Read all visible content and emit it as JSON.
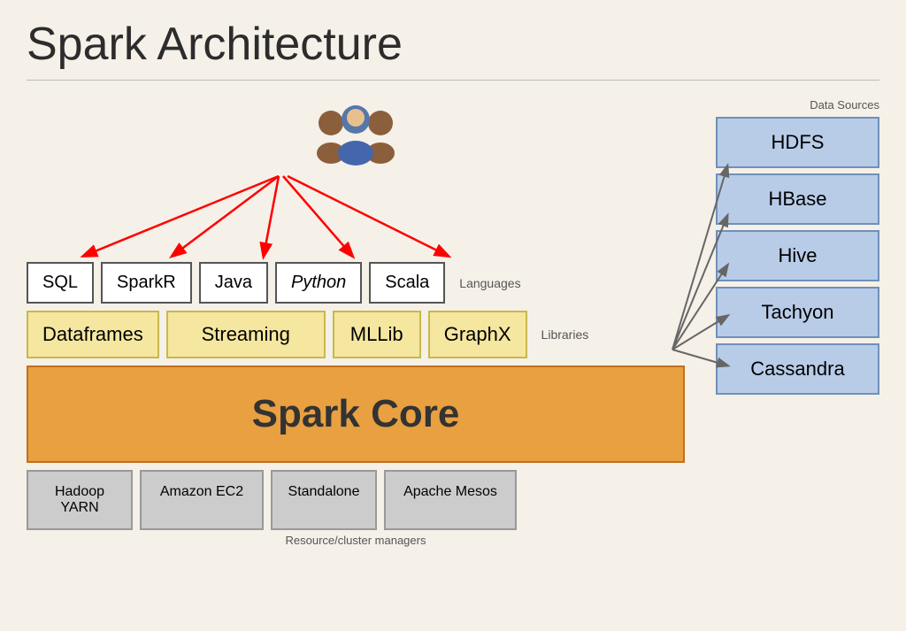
{
  "title": "Spark Architecture",
  "languages": {
    "label": "Languages",
    "items": [
      "SQL",
      "SparkR",
      "Java",
      "Python",
      "Scala"
    ]
  },
  "libraries": {
    "label": "Libraries",
    "items": [
      {
        "name": "Dataframes",
        "class": "dataframes"
      },
      {
        "name": "Streaming",
        "class": "streaming"
      },
      {
        "name": "MLLib",
        "class": "mllib"
      },
      {
        "name": "GraphX",
        "class": "graphx"
      }
    ]
  },
  "spark_core": "Spark Core",
  "cluster_managers": {
    "label": "Resource/cluster managers",
    "items": [
      "Hadoop\nYARN",
      "Amazon EC2",
      "Standalone",
      "Apache Mesos"
    ]
  },
  "data_sources": {
    "label": "Data Sources",
    "items": [
      "HDFS",
      "HBase",
      "Hive",
      "Tachyon",
      "Cassandra"
    ]
  }
}
